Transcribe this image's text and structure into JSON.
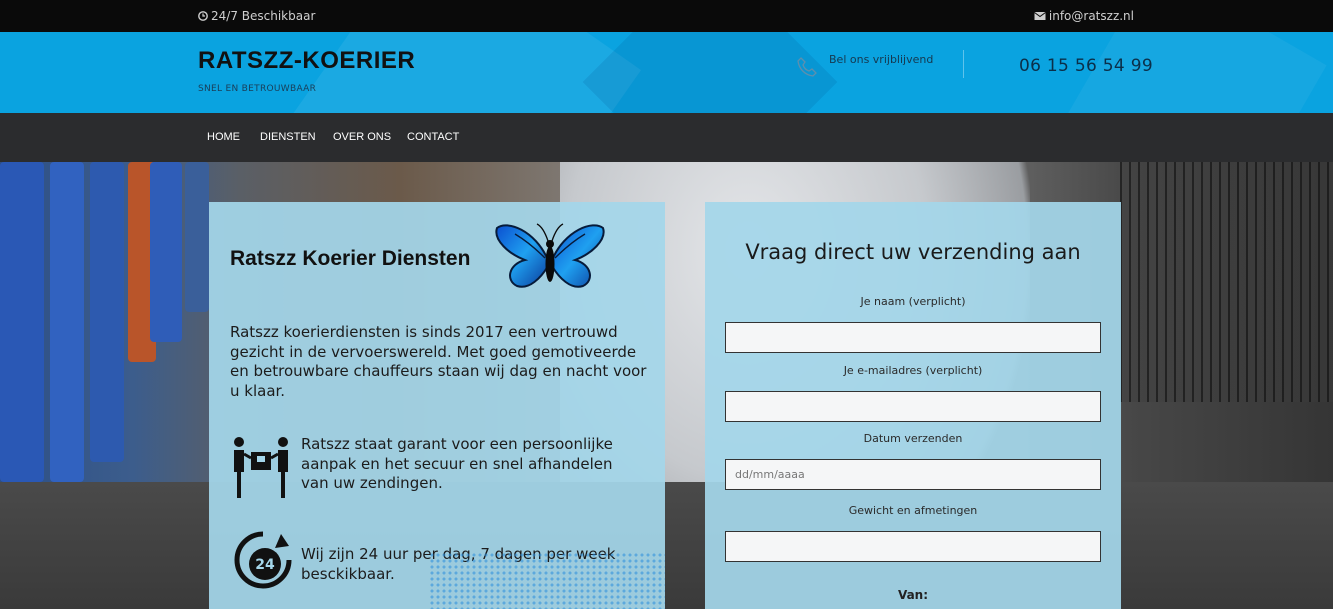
{
  "topbar": {
    "availability": "24/7 Beschikbaar",
    "email": "info@ratszz.nl"
  },
  "header": {
    "brand": "RATSZZ-KOERIER",
    "tagline": "SNEL EN BETROUWBAAR",
    "call_label": "Bel ons vrijblijvend",
    "phone": "06 15 56 54 99"
  },
  "nav": {
    "items": [
      {
        "label": "HOME"
      },
      {
        "label": "DIENSTEN"
      },
      {
        "label": "OVER ONS"
      },
      {
        "label": "CONTACT"
      }
    ]
  },
  "info": {
    "title": "Ratszz Koerier Diensten",
    "intro": "Ratszz koerierdiensten is sinds 2017 een vertrouwd gezicht in de vervoerswereld. Met goed gemotiveerde en  betrouwbare chauffeurs staan wij dag en nacht voor u klaar.",
    "feature_personal": "Ratszz  staat garant voor een persoonlijke aanpak en het secuur en snel afhandelen van uw zendingen.",
    "feature_24": "Wij zijn 24 uur per dag, 7 dagen per week besckikbaar.",
    "clock_number": "24"
  },
  "form": {
    "heading": "Vraag direct uw verzending aan",
    "name_label": "Je naam (verplicht)",
    "email_label": "Je e-mailadres (verplicht)",
    "date_label": "Datum verzenden",
    "date_placeholder": "dd/mm/aaaa",
    "weight_label": "Gewicht en afmetingen",
    "from_label": "Van:"
  },
  "colors": {
    "header_blue": "#0aa3e0",
    "nav_dark": "#2b2c2e",
    "panel_light_blue": "#a4d6ea"
  }
}
